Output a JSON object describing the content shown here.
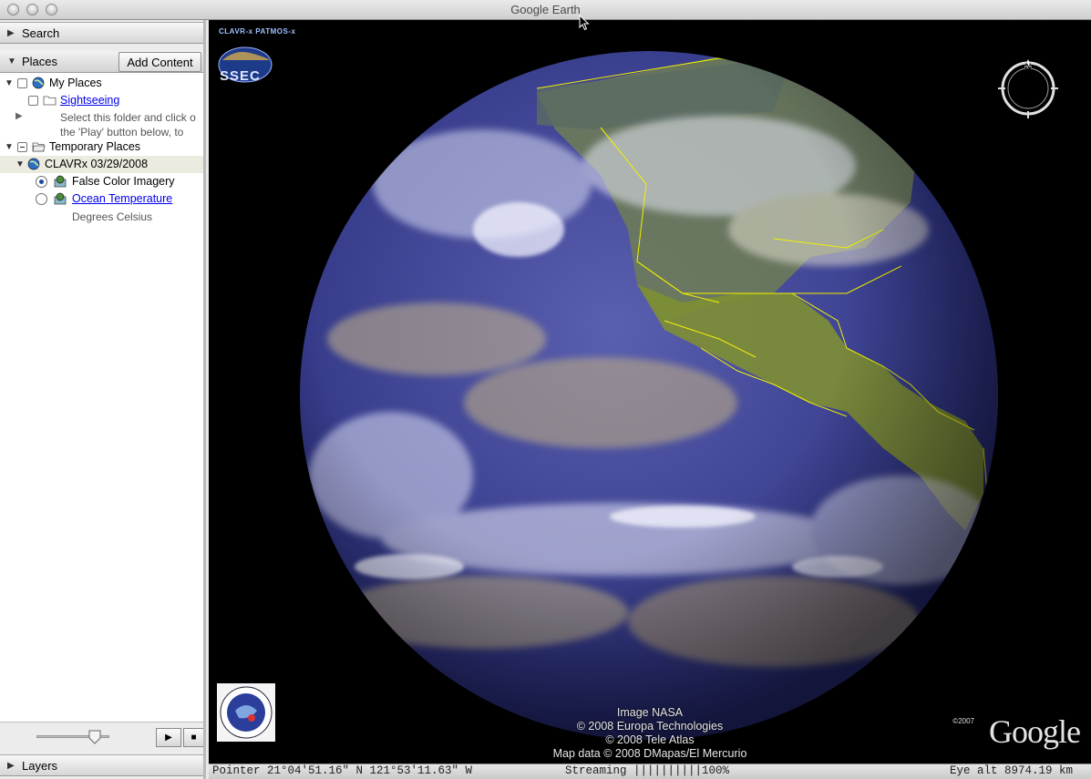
{
  "window": {
    "title": "Google Earth"
  },
  "sidebar": {
    "search_label": "Search",
    "places_label": "Places",
    "add_content_label": "Add Content",
    "layers_label": "Layers",
    "tree": {
      "my_places": "My Places",
      "sightseeing": "Sightseeing",
      "sightseeing_desc_1": "Select this folder and click o",
      "sightseeing_desc_2": "the 'Play' button below, to",
      "temporary_places": "Temporary Places",
      "clavrx": "CLAVRx 03/29/2008",
      "false_color": "False Color Imagery",
      "ocean_temp": "Ocean Temperature",
      "ocean_temp_desc": "Degrees Celsius"
    },
    "tour": {
      "tour_speed": 0.8
    }
  },
  "map": {
    "clavr_tag": "CLAVR-x PATMOS-x",
    "ssec_label": "SSEC",
    "attribution": [
      "Image NASA",
      "© 2008 Europa Technologies",
      "© 2008 Tele Atlas",
      "Map data © 2008 DMapas/El Mercurio"
    ],
    "copyright_year": "©2007",
    "brand": "Google"
  },
  "status": {
    "pointer": "Pointer  21°04'51.16\" N  121°53'11.63\" W",
    "streaming": "Streaming  ||||||||||100%",
    "eye_alt": "Eye alt  8974.19 km"
  },
  "colors": {
    "space": "#000000",
    "ocean": "#3a3f8e",
    "land": "#7e8f33",
    "border": "#f2f200",
    "link": "#0000ee"
  }
}
